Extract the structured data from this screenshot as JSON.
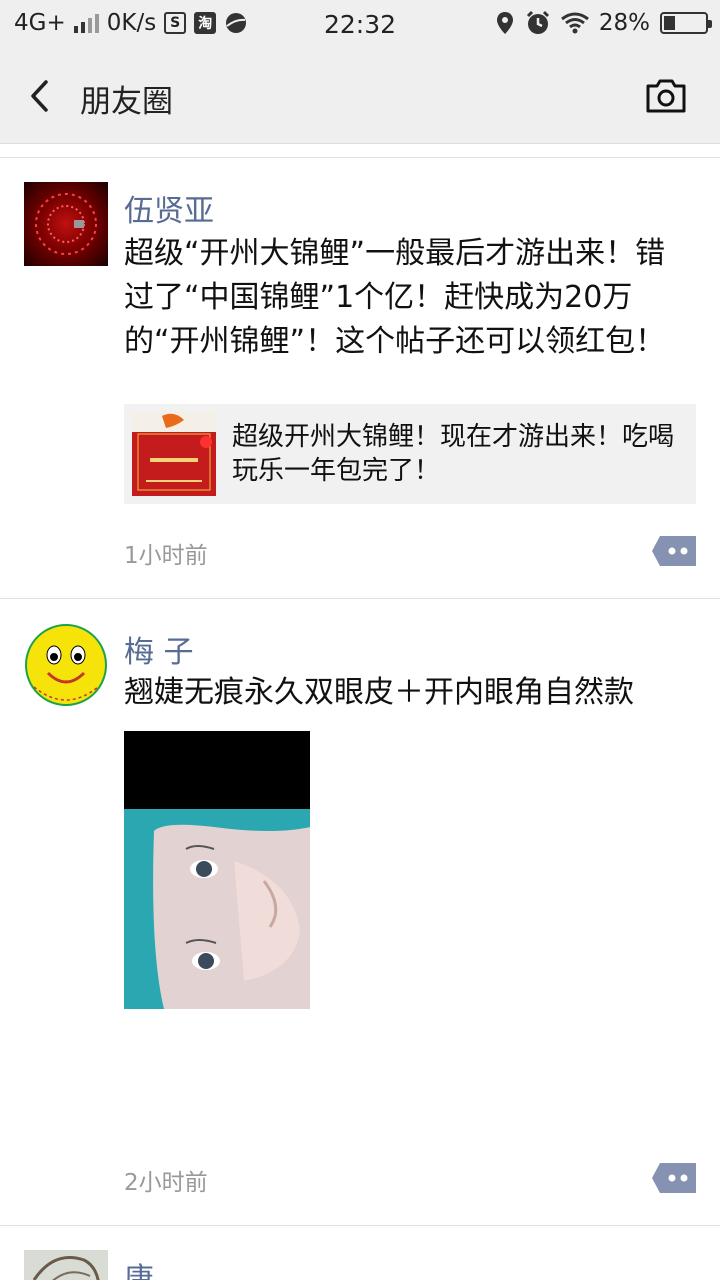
{
  "status_bar": {
    "network": "4G+",
    "speed": "0K/s",
    "icon_s": "S",
    "icon_taobao": "淘",
    "time": "22:32",
    "battery": "28%",
    "battery_level": 0.28
  },
  "nav": {
    "title": "朋友圈"
  },
  "posts": [
    {
      "author": "伍贤亚",
      "text": "超级“开州大锦鲤”一般最后才游出来！错过了“中国锦鲤”1个亿！赶快成为20万的“开州锦鲤”！这个帖子还可以领红包！",
      "link": {
        "title": "超级开州大锦鲤！现在才游出来！吃喝玩乐一年包完了！"
      },
      "time": "1小时前"
    },
    {
      "author": "梅 子",
      "text": "翘婕无痕永久双眼皮＋开内眼角自然款",
      "time": "2小时前"
    },
    {
      "author": "唐"
    }
  ],
  "colors": {
    "name": "#576b95",
    "bar_bg": "#efefef",
    "comment_btn": "#8592b1"
  }
}
